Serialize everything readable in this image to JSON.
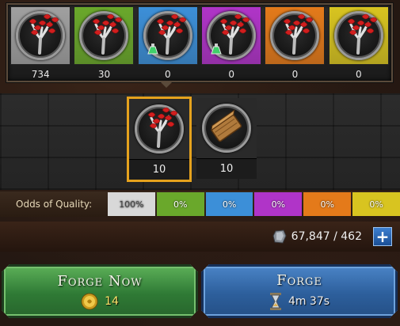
{
  "colors": {
    "tier_common": "#9a9a9a",
    "tier_uncommon": "#6aa82b",
    "tier_rare": "#3c8fd8",
    "tier_epic": "#b034c8",
    "tier_legendary": "#e47a1a",
    "tier_mythic": "#d8c420",
    "selected_border": "#e5a21d",
    "forge_now_green": "#2f7a35",
    "forge_blue": "#2d5f9c"
  },
  "tiers": [
    {
      "count": "734",
      "color": "#a0a0a0",
      "icon": "red-leaf-branch-icon",
      "potion": false
    },
    {
      "count": "30",
      "color": "#6aa82b",
      "icon": "red-leaf-branch-icon",
      "potion": false
    },
    {
      "count": "0",
      "color": "#3c8fd8",
      "icon": "red-leaf-branch-icon",
      "potion": true
    },
    {
      "count": "0",
      "color": "#b034c8",
      "icon": "red-leaf-branch-icon",
      "potion": true
    },
    {
      "count": "0",
      "color": "#e47a1a",
      "icon": "red-leaf-branch-icon",
      "potion": false
    },
    {
      "count": "0",
      "color": "#d8c420",
      "icon": "red-leaf-branch-icon",
      "potion": false
    }
  ],
  "materials": [
    {
      "count": "10",
      "icon": "red-leaf-branch-icon",
      "selected": true
    },
    {
      "count": "10",
      "icon": "wood-plank-icon",
      "selected": false
    }
  ],
  "odds": {
    "label": "Odds of Quality:",
    "cells": [
      {
        "value": "100%",
        "color": "#d8d8d8"
      },
      {
        "value": "0%",
        "color": "#6aa82b"
      },
      {
        "value": "0%",
        "color": "#3c8fd8"
      },
      {
        "value": "0%",
        "color": "#b034c8"
      },
      {
        "value": "0%",
        "color": "#e47a1a"
      },
      {
        "value": "0%",
        "color": "#d8c420"
      }
    ]
  },
  "resource": {
    "icon": "ore-icon",
    "text": "67,847 / 462",
    "plus": "+"
  },
  "buttons": {
    "forge_now": {
      "label": "Forge Now",
      "cost": "14",
      "icon": "gold-coin-icon"
    },
    "forge": {
      "label": "Forge",
      "time": "4m 37s",
      "icon": "hourglass-icon"
    }
  }
}
